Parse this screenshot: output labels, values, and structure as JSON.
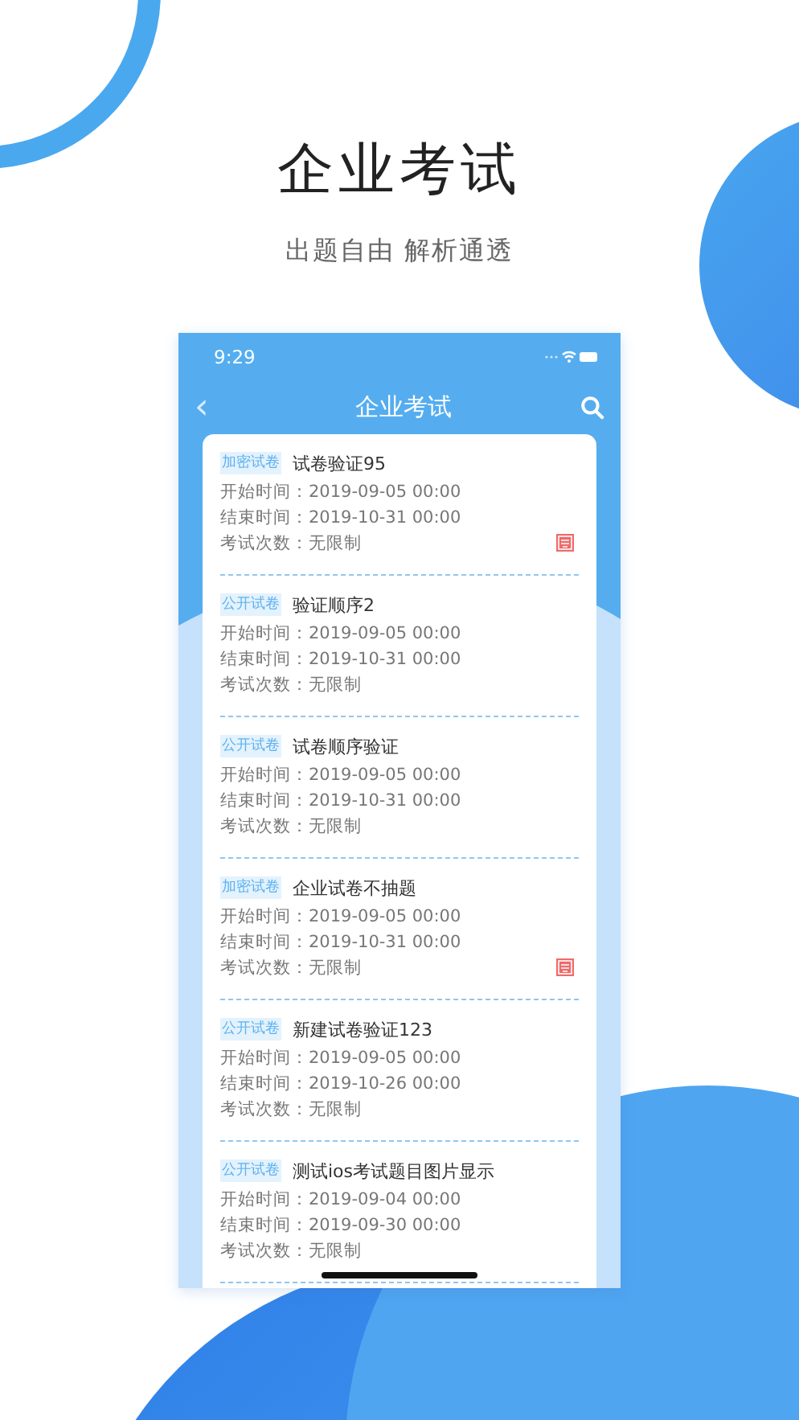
{
  "headline": "企业考试",
  "subtitle": "出题自由 解析通透",
  "phone": {
    "status_time": "9:29",
    "nav_back": "‹",
    "nav_title": "企业考试",
    "exams": [
      {
        "tag": "加密试卷",
        "title": "试卷验证95",
        "start_label": "开始时间：",
        "start": "2019-09-05 00:00",
        "end_label": "结束时间：",
        "end": "2019-10-31 00:00",
        "count_label": "考试次数：",
        "count": "无限制",
        "locked": true
      },
      {
        "tag": "公开试卷",
        "title": "验证顺序2",
        "start_label": "开始时间：",
        "start": "2019-09-05 00:00",
        "end_label": "结束时间：",
        "end": "2019-10-31 00:00",
        "count_label": "考试次数：",
        "count": "无限制",
        "locked": false
      },
      {
        "tag": "公开试卷",
        "title": "试卷顺序验证",
        "start_label": "开始时间：",
        "start": "2019-09-05 00:00",
        "end_label": "结束时间：",
        "end": "2019-10-31 00:00",
        "count_label": "考试次数：",
        "count": "无限制",
        "locked": false
      },
      {
        "tag": "加密试卷",
        "title": "企业试卷不抽题",
        "start_label": "开始时间：",
        "start": "2019-09-05 00:00",
        "end_label": "结束时间：",
        "end": "2019-10-31 00:00",
        "count_label": "考试次数：",
        "count": "无限制",
        "locked": true
      },
      {
        "tag": "公开试卷",
        "title": "新建试卷验证123",
        "start_label": "开始时间：",
        "start": "2019-09-05 00:00",
        "end_label": "结束时间：",
        "end": "2019-10-26 00:00",
        "count_label": "考试次数：",
        "count": "无限制",
        "locked": false
      },
      {
        "tag": "公开试卷",
        "title": "测试ios考试题目图片显示",
        "start_label": "开始时间：",
        "start": "2019-09-04 00:00",
        "end_label": "结束时间：",
        "end": "2019-09-30 00:00",
        "count_label": "考试次数：",
        "count": "无限制",
        "locked": false
      }
    ]
  }
}
